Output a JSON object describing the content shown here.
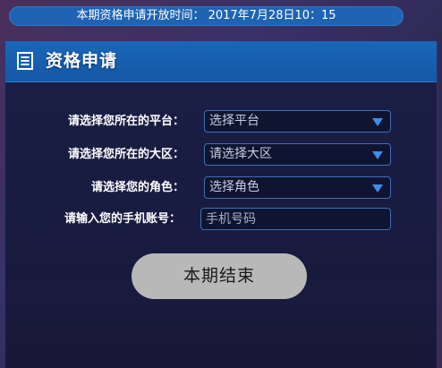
{
  "open_time": {
    "text": "本期资格申请开放时间： 2017年7月28日10：15"
  },
  "panel": {
    "title": "资格申请",
    "title_icon": "document-icon"
  },
  "form": {
    "platform": {
      "label": "请选择您所在的平台：",
      "value": "选择平台"
    },
    "region": {
      "label": "请选择您所在的大区：",
      "value": "请选择大区"
    },
    "role": {
      "label": "请选择您的角色：",
      "value": "选择角色"
    },
    "phone": {
      "label": "请输入您的手机账号：",
      "placeholder": "手机号码"
    }
  },
  "end_button": {
    "label": "本期结束"
  },
  "colors": {
    "header_blue": "#1558a6",
    "arrow_blue": "#3b8fe8",
    "panel_dark": "#181b3f",
    "button_gray": "#b8b8b8"
  }
}
